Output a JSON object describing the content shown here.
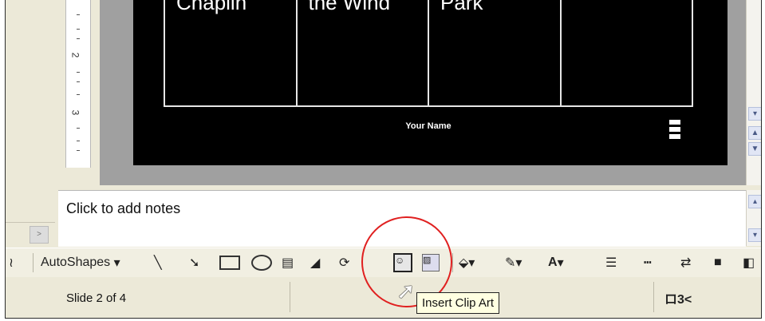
{
  "slide": {
    "cells": [
      "Chaplin",
      "the Wind",
      "Park",
      ""
    ],
    "footer_name": "Your Name"
  },
  "ruler": {
    "numbers": [
      "2",
      "3"
    ]
  },
  "notes": {
    "placeholder": "Click to add notes"
  },
  "drawing_toolbar": {
    "autoshapes_label": "AutoShapes",
    "tooltip": "Insert Clip Art",
    "icons": [
      "line-icon",
      "arrow-icon",
      "rectangle-icon",
      "oval-icon",
      "text-box-icon",
      "wordart-icon",
      "diagram-icon",
      "insert-clip-art-icon",
      "insert-picture-icon",
      "fill-color-icon",
      "line-color-icon",
      "font-color-icon",
      "line-style-icon",
      "dash-style-icon",
      "arrow-style-icon",
      "shadow-icon",
      "3d-icon"
    ]
  },
  "statusbar": {
    "slide_info": "Slide 2 of 4",
    "spelling_indicator": "ロ3<"
  },
  "colors": {
    "highlight_circle": "#e02020",
    "tooltip_bg": "#ffffe1"
  }
}
